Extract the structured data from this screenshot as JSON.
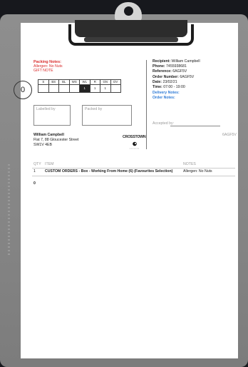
{
  "packing_notes": {
    "title": "Packing Notes:",
    "allergen": "Allergen: No Nuts",
    "gift": "GIFT NOTE"
  },
  "pack_count": "0",
  "size_grid": {
    "headers": [
      "S",
      "BS",
      "BL",
      "WS",
      "WL",
      "R",
      "GN",
      "DV"
    ],
    "values": [
      "",
      "",
      "",
      "",
      "1",
      "1",
      "1",
      ""
    ]
  },
  "labels": {
    "labelled_by": "Labelled by",
    "packed_by": "Packed by",
    "accepted_by": "Accepted by:"
  },
  "recipient": {
    "recipient_label": "Recipient:",
    "recipient_value": "William Campbell",
    "phone_label": "Phone:",
    "phone_value": "7455938681",
    "reference_label": "Reference:",
    "reference_value": "6AGF5V",
    "order_label": "Order Number:",
    "order_value": "6AGF5V",
    "date_label": "Date:",
    "date_value": "23/02/21",
    "time_label": "Time:",
    "time_value": "07:00 - 19:00",
    "delivery_notes": "Delivery Notes:",
    "order_notes": "Order Notes:"
  },
  "address": {
    "name": "William Campbell",
    "line1": "Flat 7, 88 Gloucester Street",
    "line2": "SW1V 4EB"
  },
  "order_code": "6AGF5V",
  "logo_text": "CROSSTOWN",
  "items_table": {
    "headers": {
      "qty": "QTY",
      "item": "ITEM",
      "notes": "NOTES"
    },
    "rows": [
      {
        "qty": "1",
        "item": "CUSTOM ORDERS - Box - Working From Home (6) (Favourites Selection)",
        "notes": "Allergen: No Nuts"
      }
    ]
  },
  "footer_total": "0",
  "colors": {
    "red": "#d92b2b",
    "blue": "#2f7bd6",
    "board": "#8a8a8a",
    "background": "#17181d"
  }
}
